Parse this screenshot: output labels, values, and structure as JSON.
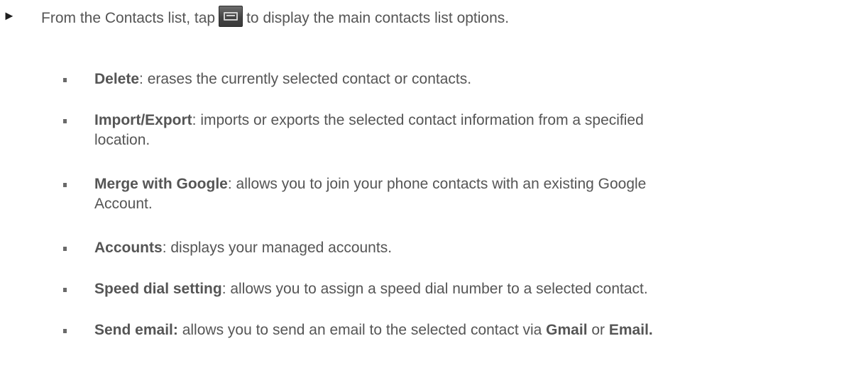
{
  "intro": {
    "arrow": "►",
    "before": "From the Contacts list, tap",
    "after": "to display the main contacts list options.",
    "menu_key_icon": "menu-key-icon"
  },
  "options": [
    {
      "term": "Delete",
      "desc": ": erases the currently selected contact or contacts."
    },
    {
      "term": "Import/Export",
      "desc": ": imports or exports the selected contact information from a specified",
      "desc2": "location."
    },
    {
      "term": "Merge with Google",
      "desc": ": allows you to join your phone contacts with an existing Google",
      "desc2": "Account."
    },
    {
      "term": "Accounts",
      "desc": ": displays your managed accounts."
    },
    {
      "term": "Speed dial setting",
      "desc": ": allows you to assign a speed dial number to a selected contact."
    },
    {
      "term": "Send email:",
      "desc": " allows you to send an email to the selected contact via ",
      "term2": "Gmail",
      "mid": " or ",
      "term3": "Email."
    }
  ]
}
